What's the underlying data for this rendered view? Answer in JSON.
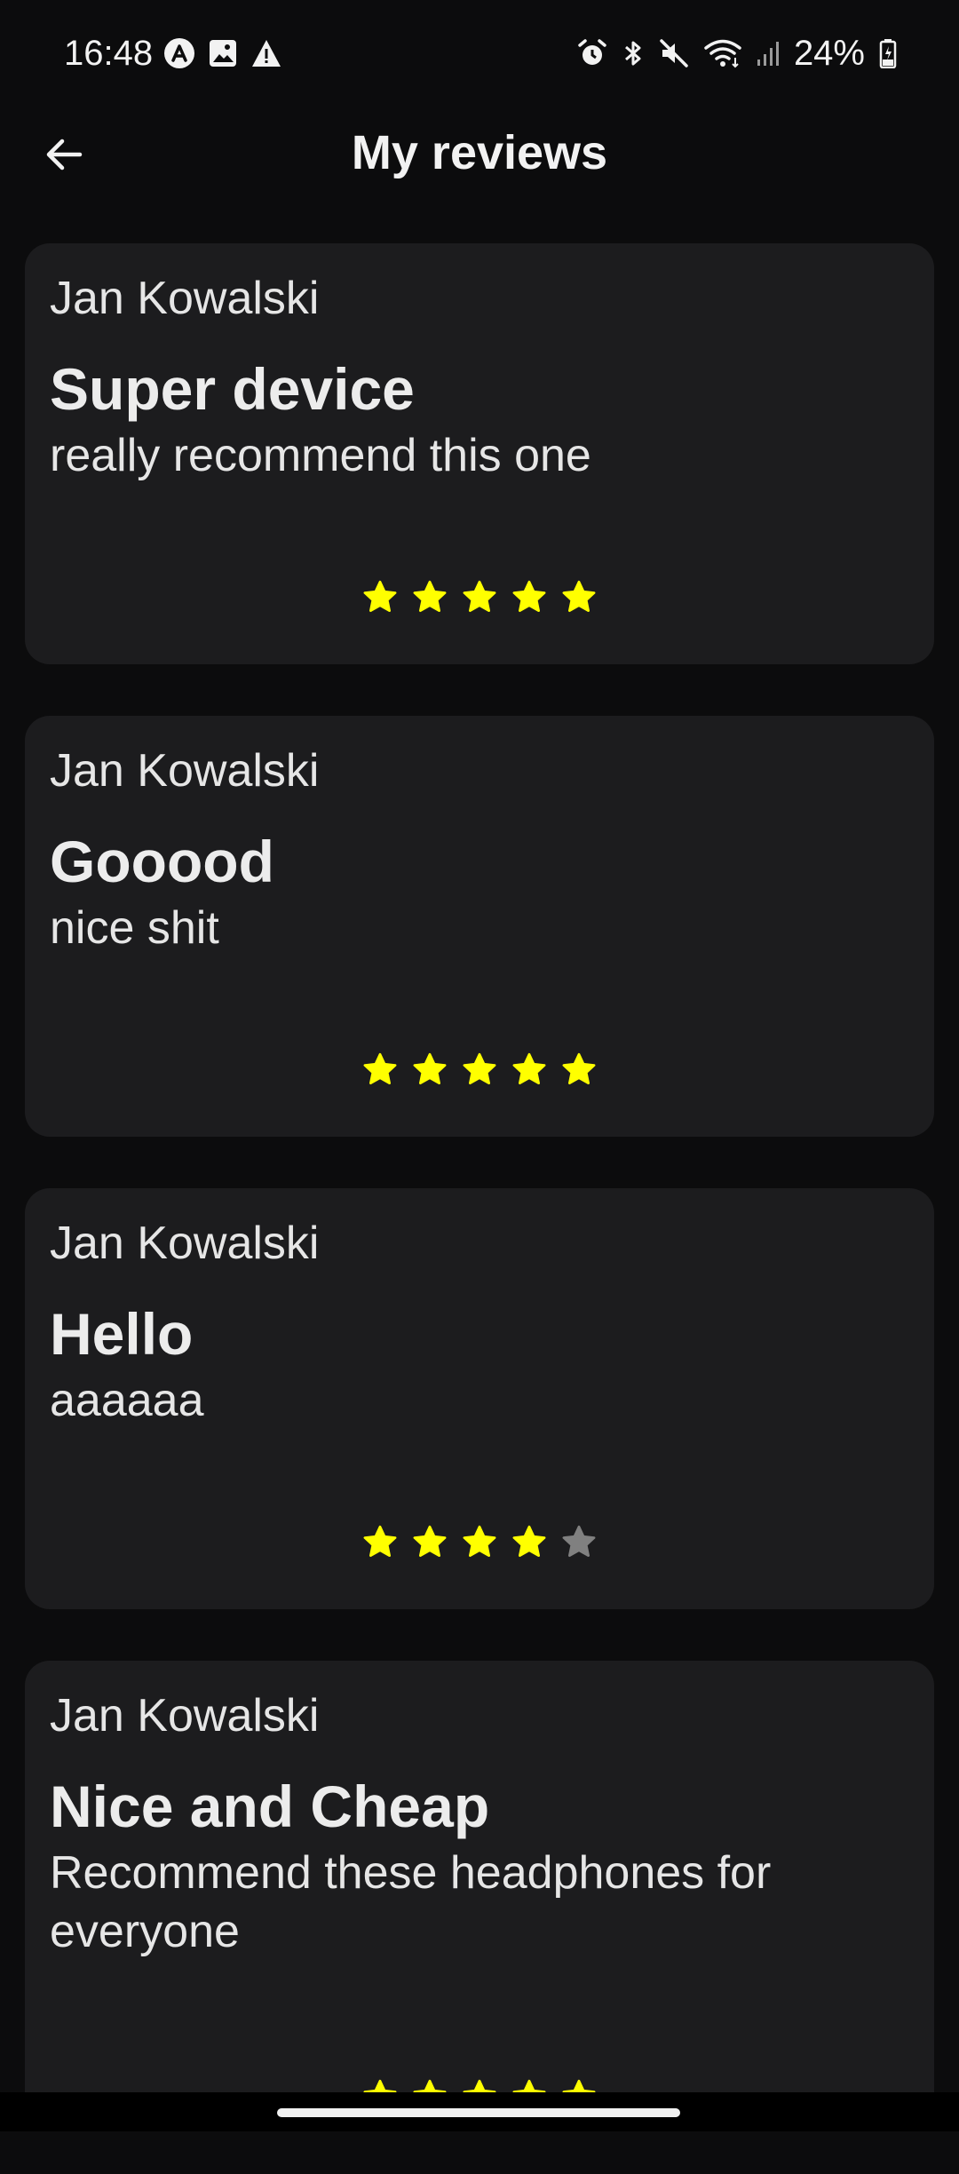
{
  "status_bar": {
    "time": "16:48",
    "battery": "24%",
    "left_icons": [
      "app-a-icon",
      "gallery-icon",
      "warning-icon"
    ],
    "right_icons": [
      "alarm-icon",
      "bluetooth-icon",
      "mute-icon",
      "wifi-icon",
      "signal-icon",
      "battery-icon"
    ]
  },
  "app_bar": {
    "title": "My reviews",
    "back_icon": "arrow-left-icon"
  },
  "colors": {
    "background": "#0c0c0d",
    "card": "#1c1c1e",
    "star_filled": "#ffff00",
    "star_empty": "#808080"
  },
  "reviews": [
    {
      "author": "Jan Kowalski",
      "title": "Super device",
      "body": "really recommend this one",
      "rating": 5,
      "max_rating": 5
    },
    {
      "author": "Jan Kowalski",
      "title": "Gooood",
      "body": "nice shit",
      "rating": 5,
      "max_rating": 5
    },
    {
      "author": "Jan Kowalski",
      "title": "Hello",
      "body": "aaaaaa",
      "rating": 4,
      "max_rating": 5
    },
    {
      "author": "Jan Kowalski",
      "title": "Nice and Cheap",
      "body": "Recommend these headphones for everyone",
      "rating": 5,
      "max_rating": 5
    }
  ]
}
